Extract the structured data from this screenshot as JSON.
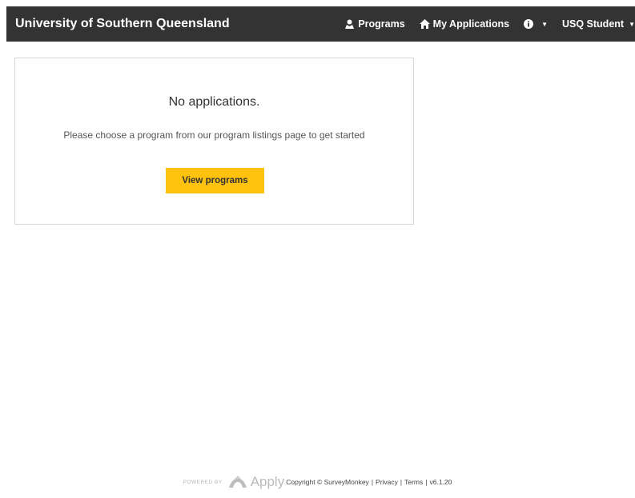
{
  "navbar": {
    "brand": "University of Southern Queensland",
    "programs_label": "Programs",
    "my_applications_label": "My Applications",
    "user_label": "USQ Student",
    "caret": "▼"
  },
  "card": {
    "title": "No applications.",
    "subtitle": "Please choose a program from our program listings page to get started",
    "button_label": "View programs"
  },
  "footer": {
    "powered_by": "POWERED BY",
    "logo_text": "Apply",
    "copyright": "Copyright © SurveyMonkey",
    "privacy": "Privacy",
    "terms": "Terms",
    "version": "v6.1.20",
    "separator": "|"
  },
  "colors": {
    "navbar_bg": "#333333",
    "button_bg": "#ffc20e",
    "card_border": "#d6d6d6"
  }
}
